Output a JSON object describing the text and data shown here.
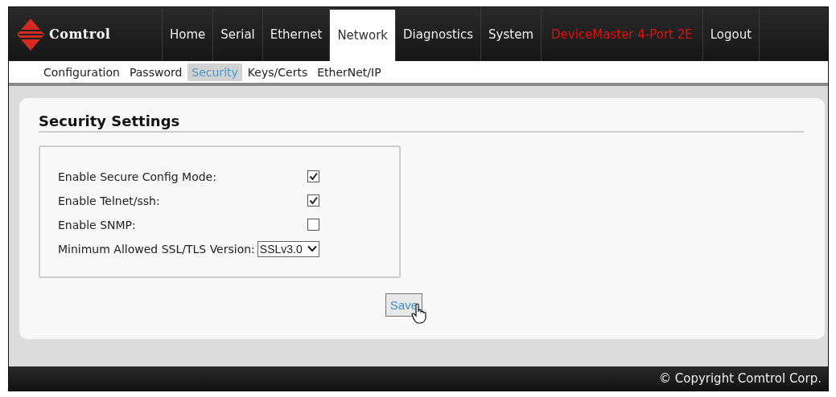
{
  "brand": {
    "name": "Comtrol"
  },
  "nav": [
    {
      "label": "Home",
      "selected": false
    },
    {
      "label": "Serial",
      "selected": false
    },
    {
      "label": "Ethernet",
      "selected": false
    },
    {
      "label": "Network",
      "selected": true
    },
    {
      "label": "Diagnostics",
      "selected": false
    },
    {
      "label": "System",
      "selected": false
    }
  ],
  "device_name": "DeviceMaster 4-Port 2E",
  "logout": "Logout",
  "subnav": [
    {
      "label": "Configuration",
      "selected": false
    },
    {
      "label": "Password",
      "selected": false
    },
    {
      "label": "Security",
      "selected": true
    },
    {
      "label": "Keys/Certs",
      "selected": false
    },
    {
      "label": "EtherNet/IP",
      "selected": false
    }
  ],
  "section_title": "Security Settings",
  "settings": [
    {
      "kind": "checkbox",
      "label": "Enable Secure Config Mode:",
      "checked": true
    },
    {
      "kind": "checkbox",
      "label": "Enable Telnet/ssh:",
      "checked": true
    },
    {
      "kind": "checkbox",
      "label": "Enable SNMP:",
      "checked": false
    },
    {
      "kind": "select",
      "label": "Minimum Allowed SSL/TLS Version:",
      "value": "SSLv3.0"
    }
  ],
  "save_button": "Save",
  "footer": "© Copyright Comtrol Corp."
}
